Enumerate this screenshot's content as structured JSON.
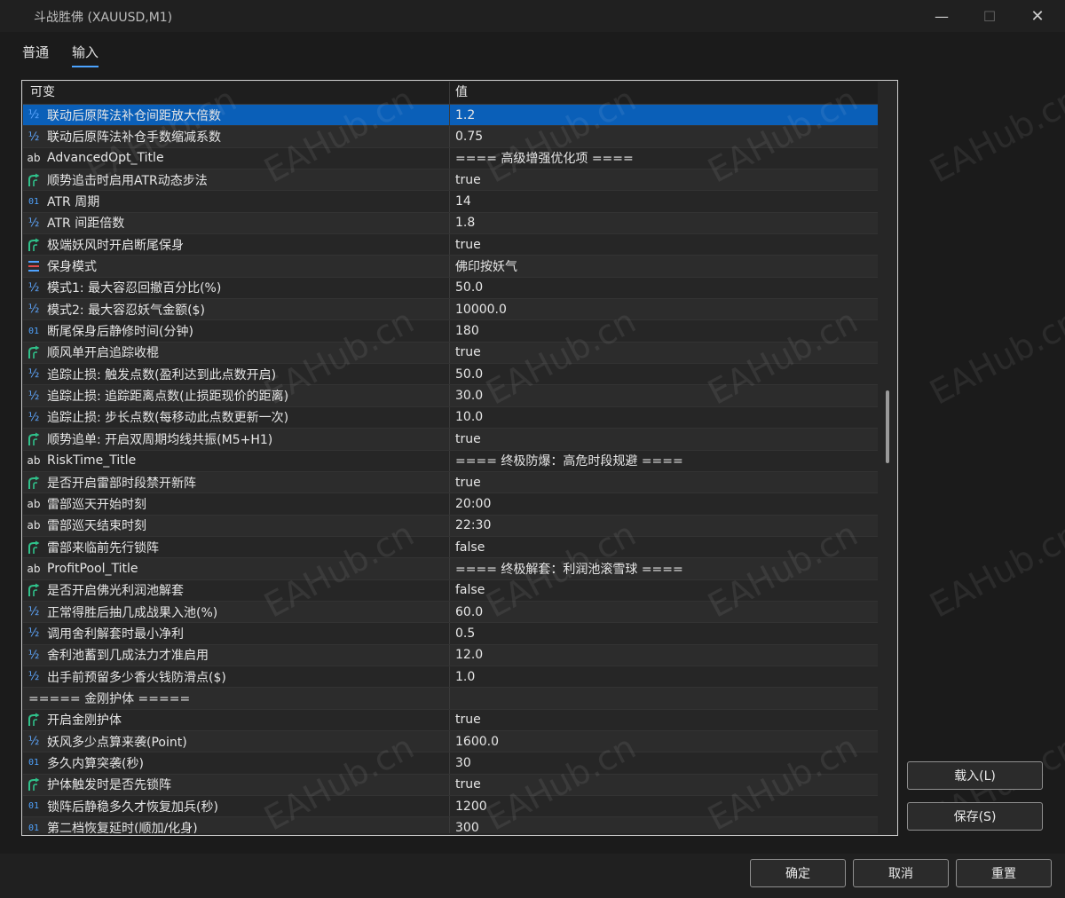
{
  "window": {
    "title": "斗战胜佛 (XAUUSD,M1)",
    "min_glyph": "—",
    "max_glyph": "☐",
    "close_glyph": "✕"
  },
  "tabs": [
    {
      "label": "普通",
      "active": false
    },
    {
      "label": "输入",
      "active": true
    }
  ],
  "grid": {
    "headers": {
      "name": "可变",
      "value": "值"
    },
    "rows": [
      {
        "type": "double",
        "name": "联动后原阵法补仓间距放大倍数",
        "value": "1.2",
        "selected": true
      },
      {
        "type": "double",
        "name": "联动后原阵法补仓手数缩减系数",
        "value": "0.75"
      },
      {
        "type": "string",
        "name": "AdvancedOpt_Title",
        "value": "==== 高级增强优化项 ===="
      },
      {
        "type": "bool",
        "name": "顺势追击时启用ATR动态步法",
        "value": "true"
      },
      {
        "type": "int",
        "name": "ATR 周期",
        "value": "14"
      },
      {
        "type": "double",
        "name": "ATR 间距倍数",
        "value": "1.8"
      },
      {
        "type": "bool",
        "name": "极端妖风时开启断尾保身",
        "value": "true"
      },
      {
        "type": "enum",
        "name": "保身模式",
        "value": "佛印按妖气"
      },
      {
        "type": "double",
        "name": "模式1: 最大容忍回撤百分比(%)",
        "value": "50.0"
      },
      {
        "type": "double",
        "name": "模式2: 最大容忍妖气金额($)",
        "value": "10000.0"
      },
      {
        "type": "int",
        "name": "断尾保身后静修时间(分钟)",
        "value": "180"
      },
      {
        "type": "bool",
        "name": "顺风单开启追踪收棍",
        "value": "true"
      },
      {
        "type": "double",
        "name": "追踪止损: 触发点数(盈利达到此点数开启)",
        "value": "50.0"
      },
      {
        "type": "double",
        "name": "追踪止损: 追踪距离点数(止损距现价的距离)",
        "value": "30.0"
      },
      {
        "type": "double",
        "name": "追踪止损: 步长点数(每移动此点数更新一次)",
        "value": "10.0"
      },
      {
        "type": "bool",
        "name": "顺势追单: 开启双周期均线共振(M5+H1)",
        "value": "true"
      },
      {
        "type": "string",
        "name": "RiskTime_Title",
        "value": "==== 终极防爆：高危时段规避 ===="
      },
      {
        "type": "bool",
        "name": "是否开启雷部时段禁开新阵",
        "value": "true"
      },
      {
        "type": "string",
        "name": "雷部巡天开始时刻",
        "value": "20:00"
      },
      {
        "type": "string",
        "name": "雷部巡天结束时刻",
        "value": "22:30"
      },
      {
        "type": "bool",
        "name": "雷部来临前先行锁阵",
        "value": "false"
      },
      {
        "type": "string",
        "name": "ProfitPool_Title",
        "value": "==== 终极解套：利润池滚雪球 ===="
      },
      {
        "type": "bool",
        "name": "是否开启佛光利润池解套",
        "value": "false"
      },
      {
        "type": "double",
        "name": "正常得胜后抽几成战果入池(%)",
        "value": "60.0"
      },
      {
        "type": "double",
        "name": "调用舍利解套时最小净利",
        "value": "0.5"
      },
      {
        "type": "double",
        "name": "舍利池蓄到几成法力才准启用",
        "value": "12.0"
      },
      {
        "type": "double",
        "name": "出手前预留多少香火钱防滑点($)",
        "value": "1.0"
      },
      {
        "type": "section",
        "name": "===== 金刚护体 =====",
        "value": ""
      },
      {
        "type": "bool",
        "name": "开启金刚护体",
        "value": "true"
      },
      {
        "type": "double",
        "name": "妖风多少点算来袭(Point)",
        "value": "1600.0"
      },
      {
        "type": "int",
        "name": "多久内算突袭(秒)",
        "value": "30"
      },
      {
        "type": "bool",
        "name": "护体触发时是否先锁阵",
        "value": "true"
      },
      {
        "type": "int",
        "name": "锁阵后静稳多久才恢复加兵(秒)",
        "value": "1200"
      },
      {
        "type": "int",
        "name": "第二档恢复延时(顺加/化身)",
        "value": "300"
      }
    ]
  },
  "icons": {
    "double": "½",
    "int": "01",
    "string": "ab",
    "bool": "bool-arrow-icon",
    "enum": "enum-list-icon"
  },
  "colors": {
    "selected_row": "#0a5fb8",
    "tab_underline": "#4ca3ff"
  },
  "watermark": "EAHub.cn",
  "buttons": {
    "load": "载入(L)",
    "save": "保存(S)",
    "ok": "确定",
    "cancel": "取消",
    "reset": "重置"
  }
}
